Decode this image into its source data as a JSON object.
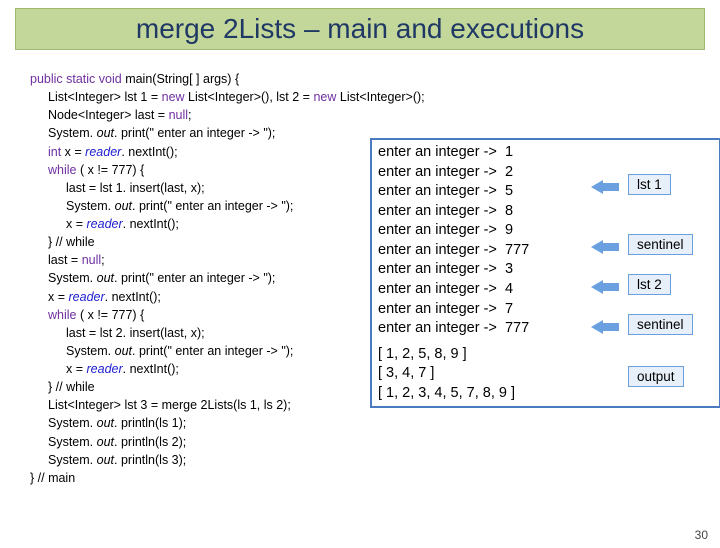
{
  "title": "merge 2Lists – main and  executions",
  "code": {
    "l1a": "public static void",
    "l1b": " main(String[ ] args)  {",
    "l2": "List<Integer>   lst 1 = ",
    "l2b": "new",
    "l2c": " List<Integer>(),  lst 2 = ",
    "l2d": "new",
    "l2e": " List<Integer>();",
    "l3": "Node<Integer>  last = ",
    "l3b": "null",
    "l3c": ";",
    "l4a": "System. ",
    "l4b": "out",
    "l4c": ". print(\" enter an integer -> \");",
    "l5a": "int",
    "l5b": " x = ",
    "l5c": "reader",
    "l5d": ". nextInt();",
    "l6a": "while",
    "l6b": " ( x != 777)  {",
    "l7": "last = lst 1. insert(last, x);",
    "l8a": "System. ",
    "l8b": "out",
    "l8c": ". print(\" enter an integer -> \");",
    "l9a": "x = ",
    "l9b": "reader",
    "l9c": ". nextInt();",
    "l10": "} // while",
    "l11a": "last = ",
    "l11b": "null",
    "l11c": ";",
    "l12a": "System. ",
    "l12b": "out",
    "l12c": ". print(\" enter an integer -> \");",
    "l13a": "x = ",
    "l13b": "reader",
    "l13c": ". nextInt();",
    "l14a": "while",
    "l14b": " ( x != 777)  {",
    "l15": "last = lst 2. insert(last, x);",
    "l16a": "System. ",
    "l16b": "out",
    "l16c": ". print(\" enter an integer -> \");",
    "l17a": "x = ",
    "l17b": "reader",
    "l17c": ". nextInt();",
    "l18": "} // while",
    "l19": "List<Integer>    lst 3  = merge 2Lists(ls 1, ls 2);",
    "l20a": "System. ",
    "l20b": "out",
    "l20c": ". println(ls 1);",
    "l21a": "System. ",
    "l21b": "out",
    "l21c": ". println(ls 2);",
    "l22a": "System. ",
    "l22b": "out",
    "l22c": ". println(ls 3);",
    "l23": "} // main"
  },
  "exec": {
    "p1": "enter an integer ->  1",
    "p2": "enter an integer ->  2",
    "p3": "enter an integer ->  5",
    "p4": "enter an integer ->  8",
    "p5": "enter an integer ->  9",
    "p6": "enter an integer ->  777",
    "p7": "enter an integer ->  3",
    "p8": "enter an integer ->  4",
    "p9": "enter an integer ->  7",
    "p10": "enter an integer ->  777",
    "o1": "[ 1, 2, 5, 8, 9 ]",
    "o2": "[ 3, 4, 7 ]",
    "o3": "[ 1, 2, 3, 4, 5, 7, 8, 9 ]"
  },
  "labels": {
    "lst1": "lst 1",
    "sentinel1": "sentinel",
    "lst2": "lst 2",
    "sentinel2": "sentinel",
    "output": "output"
  },
  "page": "30"
}
